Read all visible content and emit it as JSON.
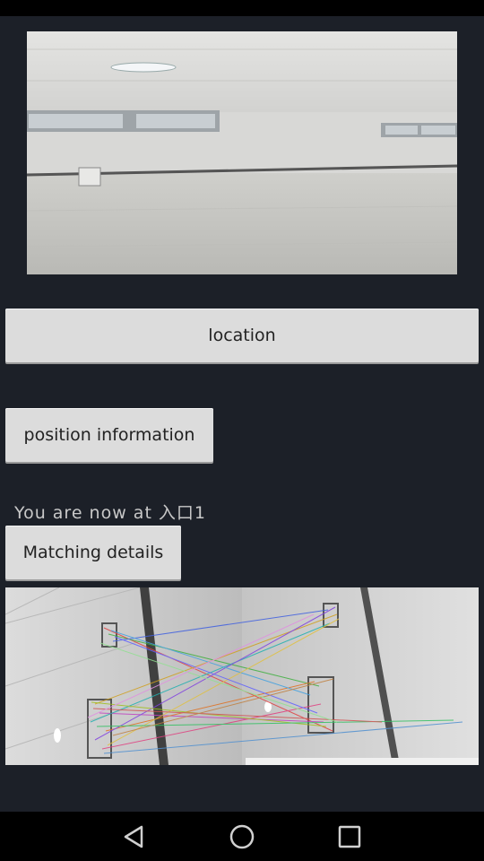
{
  "buttons": {
    "location": "location",
    "position_information": "position information",
    "matching_details": "Matching details"
  },
  "status_text": "You are now at 入口1",
  "icons": {
    "back": "back-icon",
    "home": "home-icon",
    "recents": "recents-icon"
  },
  "colors": {
    "background": "#1c2028",
    "button": "#dcdcdc"
  }
}
